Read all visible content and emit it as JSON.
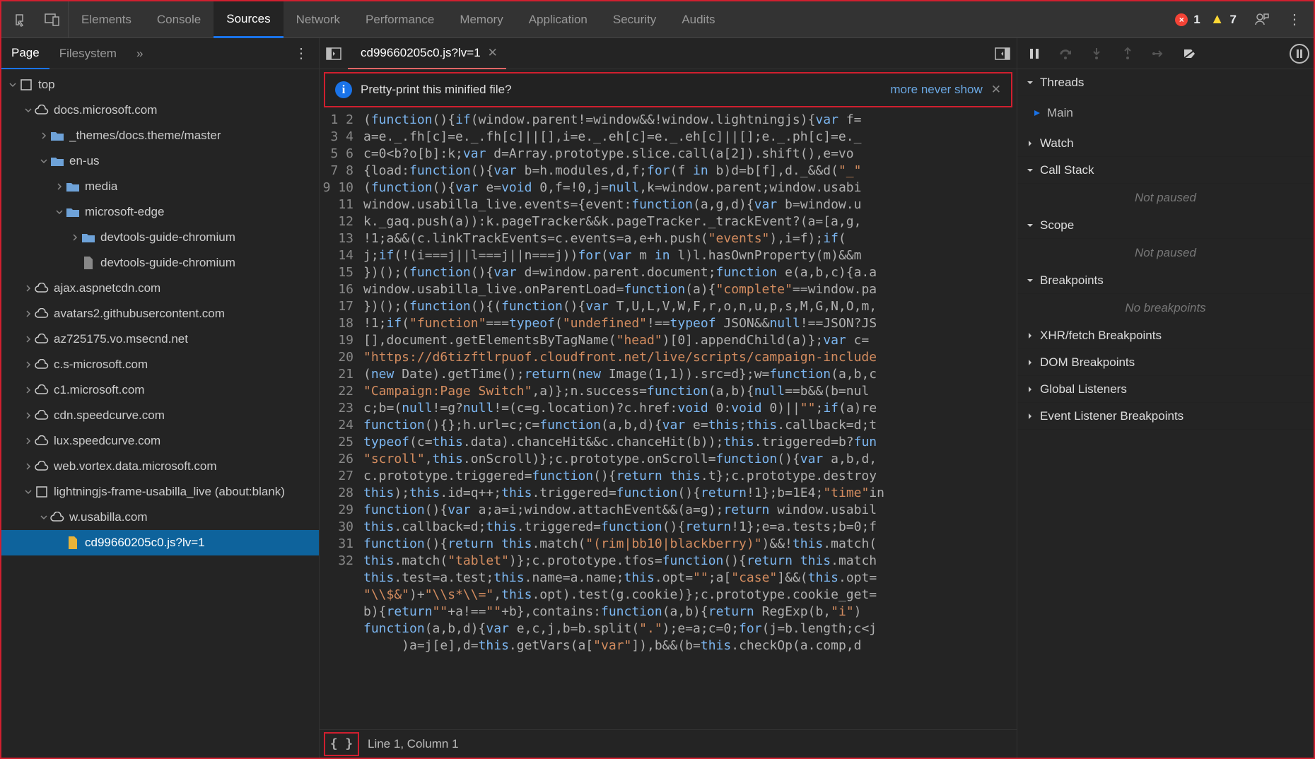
{
  "top_tabs": {
    "items": [
      "Elements",
      "Console",
      "Sources",
      "Network",
      "Performance",
      "Memory",
      "Application",
      "Security",
      "Audits"
    ],
    "active_index": 2,
    "errors": "1",
    "warnings": "7"
  },
  "left_tabs": {
    "items": [
      "Page",
      "Filesystem"
    ],
    "more": "»",
    "active_index": 0
  },
  "tree": [
    {
      "d": 0,
      "ic": "box",
      "arr": "d",
      "t": "top"
    },
    {
      "d": 1,
      "ic": "cloud",
      "arr": "d",
      "t": "docs.microsoft.com"
    },
    {
      "d": 2,
      "ic": "folder",
      "arr": "r",
      "t": "_themes/docs.theme/master"
    },
    {
      "d": 2,
      "ic": "folder",
      "arr": "d",
      "t": "en-us"
    },
    {
      "d": 3,
      "ic": "folder",
      "arr": "r",
      "t": "media"
    },
    {
      "d": 3,
      "ic": "folder",
      "arr": "d",
      "t": "microsoft-edge"
    },
    {
      "d": 4,
      "ic": "folder",
      "arr": "r",
      "t": "devtools-guide-chromium"
    },
    {
      "d": 4,
      "ic": "file",
      "arr": "",
      "t": "devtools-guide-chromium"
    },
    {
      "d": 1,
      "ic": "cloud",
      "arr": "r",
      "t": "ajax.aspnetcdn.com"
    },
    {
      "d": 1,
      "ic": "cloud",
      "arr": "r",
      "t": "avatars2.githubusercontent.com"
    },
    {
      "d": 1,
      "ic": "cloud",
      "arr": "r",
      "t": "az725175.vo.msecnd.net"
    },
    {
      "d": 1,
      "ic": "cloud",
      "arr": "r",
      "t": "c.s-microsoft.com"
    },
    {
      "d": 1,
      "ic": "cloud",
      "arr": "r",
      "t": "c1.microsoft.com"
    },
    {
      "d": 1,
      "ic": "cloud",
      "arr": "r",
      "t": "cdn.speedcurve.com"
    },
    {
      "d": 1,
      "ic": "cloud",
      "arr": "r",
      "t": "lux.speedcurve.com"
    },
    {
      "d": 1,
      "ic": "cloud",
      "arr": "r",
      "t": "web.vortex.data.microsoft.com"
    },
    {
      "d": 1,
      "ic": "box",
      "arr": "d",
      "t": "lightningjs-frame-usabilla_live (about:blank)"
    },
    {
      "d": 2,
      "ic": "cloud",
      "arr": "d",
      "t": "w.usabilla.com"
    },
    {
      "d": 3,
      "ic": "js",
      "arr": "",
      "t": "cd99660205c0.js?lv=1",
      "sel": true
    }
  ],
  "editor": {
    "tab_name": "cd99660205c0.js?lv=1",
    "info_text": "Pretty-print this minified file?",
    "info_link": "more never show",
    "status": "Line 1, Column 1",
    "pretty_label": "{ }"
  },
  "code_lines": [
    [
      {
        "c": "p",
        "t": "("
      },
      {
        "c": "k",
        "t": "function"
      },
      {
        "c": "p",
        "t": "(){"
      },
      {
        "c": "k",
        "t": "if"
      },
      {
        "c": "p",
        "t": "(window.parent!=window&&!window.lightningjs){"
      },
      {
        "c": "k",
        "t": "var"
      },
      {
        "c": "p",
        "t": " f="
      }
    ],
    [
      {
        "c": "p",
        "t": "a=e._.fh[c]=e._.fh[c]||[],i=e._.eh[c]=e._.eh[c]||[];e._.ph[c]=e._"
      }
    ],
    [
      {
        "c": "p",
        "t": "c=0<b?o[b]:k;"
      },
      {
        "c": "k",
        "t": "var"
      },
      {
        "c": "p",
        "t": " d=Array.prototype.slice.call(a[2]).shift(),e=vo"
      }
    ],
    [
      {
        "c": "p",
        "t": "{load:"
      },
      {
        "c": "k",
        "t": "function"
      },
      {
        "c": "p",
        "t": "(){"
      },
      {
        "c": "k",
        "t": "var"
      },
      {
        "c": "p",
        "t": " b=h.modules,d,f;"
      },
      {
        "c": "k",
        "t": "for"
      },
      {
        "c": "p",
        "t": "(f "
      },
      {
        "c": "k",
        "t": "in"
      },
      {
        "c": "p",
        "t": " b)d=b[f],d._&&d("
      },
      {
        "c": "s",
        "t": "\"_\""
      }
    ],
    [
      {
        "c": "p",
        "t": "("
      },
      {
        "c": "k",
        "t": "function"
      },
      {
        "c": "p",
        "t": "(){"
      },
      {
        "c": "k",
        "t": "var"
      },
      {
        "c": "p",
        "t": " e="
      },
      {
        "c": "k",
        "t": "void"
      },
      {
        "c": "p",
        "t": " 0,f=!0,j="
      },
      {
        "c": "k",
        "t": "null"
      },
      {
        "c": "p",
        "t": ",k=window.parent;window.usabi"
      }
    ],
    [
      {
        "c": "p",
        "t": "window.usabilla_live.events={event:"
      },
      {
        "c": "k",
        "t": "function"
      },
      {
        "c": "p",
        "t": "(a,g,d){"
      },
      {
        "c": "k",
        "t": "var"
      },
      {
        "c": "p",
        "t": " b=window.u"
      }
    ],
    [
      {
        "c": "p",
        "t": "k._gaq.push(a)):k.pageTracker&&k.pageTracker._trackEvent?(a=[a,g,"
      }
    ],
    [
      {
        "c": "p",
        "t": "!1;a&&(c.linkTrackEvents=c.events=a,e+h.push("
      },
      {
        "c": "s",
        "t": "\"events\""
      },
      {
        "c": "p",
        "t": "),i=f);"
      },
      {
        "c": "k",
        "t": "if"
      },
      {
        "c": "p",
        "t": "("
      }
    ],
    [
      {
        "c": "p",
        "t": "j;"
      },
      {
        "c": "k",
        "t": "if"
      },
      {
        "c": "p",
        "t": "(!(i===j||l===j||n===j))"
      },
      {
        "c": "k",
        "t": "for"
      },
      {
        "c": "p",
        "t": "("
      },
      {
        "c": "k",
        "t": "var"
      },
      {
        "c": "p",
        "t": " m "
      },
      {
        "c": "k",
        "t": "in"
      },
      {
        "c": "p",
        "t": " l)l.hasOwnProperty(m)&&m"
      }
    ],
    [
      {
        "c": "p",
        "t": "})();("
      },
      {
        "c": "k",
        "t": "function"
      },
      {
        "c": "p",
        "t": "(){"
      },
      {
        "c": "k",
        "t": "var"
      },
      {
        "c": "p",
        "t": " d=window.parent.document;"
      },
      {
        "c": "k",
        "t": "function"
      },
      {
        "c": "p",
        "t": " e(a,b,c){a.a"
      }
    ],
    [
      {
        "c": "p",
        "t": "window.usabilla_live.onParentLoad="
      },
      {
        "c": "k",
        "t": "function"
      },
      {
        "c": "p",
        "t": "(a){"
      },
      {
        "c": "s",
        "t": "\"complete\""
      },
      {
        "c": "p",
        "t": "==window.pa"
      }
    ],
    [
      {
        "c": "p",
        "t": "})();("
      },
      {
        "c": "k",
        "t": "function"
      },
      {
        "c": "p",
        "t": "(){("
      },
      {
        "c": "k",
        "t": "function"
      },
      {
        "c": "p",
        "t": "(){"
      },
      {
        "c": "k",
        "t": "var"
      },
      {
        "c": "p",
        "t": " T,U,L,V,W,F,r,o,n,u,p,s,M,G,N,O,m,"
      }
    ],
    [
      {
        "c": "p",
        "t": "!1;"
      },
      {
        "c": "k",
        "t": "if"
      },
      {
        "c": "p",
        "t": "("
      },
      {
        "c": "s",
        "t": "\"function\""
      },
      {
        "c": "p",
        "t": "==="
      },
      {
        "c": "k",
        "t": "typeof"
      },
      {
        "c": "p",
        "t": "("
      },
      {
        "c": "s",
        "t": "\"undefined\""
      },
      {
        "c": "p",
        "t": "!=="
      },
      {
        "c": "k",
        "t": "typeof"
      },
      {
        "c": "p",
        "t": " JSON&&"
      },
      {
        "c": "k",
        "t": "null"
      },
      {
        "c": "p",
        "t": "!==JSON?JS"
      }
    ],
    [
      {
        "c": "p",
        "t": "[],document.getElementsByTagName("
      },
      {
        "c": "s",
        "t": "\"head\""
      },
      {
        "c": "p",
        "t": ")[0].appendChild(a)};"
      },
      {
        "c": "k",
        "t": "var"
      },
      {
        "c": "p",
        "t": " c="
      }
    ],
    [
      {
        "c": "s",
        "t": "\"https://d6tizftlrpuof.cloudfront.net/live/scripts/campaign-include"
      }
    ],
    [
      {
        "c": "p",
        "t": "("
      },
      {
        "c": "k",
        "t": "new"
      },
      {
        "c": "p",
        "t": " Date).getTime();"
      },
      {
        "c": "k",
        "t": "return"
      },
      {
        "c": "p",
        "t": "("
      },
      {
        "c": "k",
        "t": "new"
      },
      {
        "c": "p",
        "t": " Image(1,1)).src=d};w="
      },
      {
        "c": "k",
        "t": "function"
      },
      {
        "c": "p",
        "t": "(a,b,c"
      }
    ],
    [
      {
        "c": "s",
        "t": "\"Campaign:Page Switch\""
      },
      {
        "c": "p",
        "t": ",a)};n.success="
      },
      {
        "c": "k",
        "t": "function"
      },
      {
        "c": "p",
        "t": "(a,b){"
      },
      {
        "c": "k",
        "t": "null"
      },
      {
        "c": "p",
        "t": "==b&&(b=nul"
      }
    ],
    [
      {
        "c": "p",
        "t": "c;b=("
      },
      {
        "c": "k",
        "t": "null"
      },
      {
        "c": "p",
        "t": "!=g?"
      },
      {
        "c": "k",
        "t": "null"
      },
      {
        "c": "p",
        "t": "!=(c=g.location)?c.href:"
      },
      {
        "c": "k",
        "t": "void"
      },
      {
        "c": "p",
        "t": " 0:"
      },
      {
        "c": "k",
        "t": "void"
      },
      {
        "c": "p",
        "t": " 0)||"
      },
      {
        "c": "s",
        "t": "\"\""
      },
      {
        "c": "p",
        "t": ";"
      },
      {
        "c": "k",
        "t": "if"
      },
      {
        "c": "p",
        "t": "(a)re"
      }
    ],
    [
      {
        "c": "k",
        "t": "function"
      },
      {
        "c": "p",
        "t": "(){};h.url=c;c="
      },
      {
        "c": "k",
        "t": "function"
      },
      {
        "c": "p",
        "t": "(a,b,d){"
      },
      {
        "c": "k",
        "t": "var"
      },
      {
        "c": "p",
        "t": " e="
      },
      {
        "c": "k",
        "t": "this"
      },
      {
        "c": "p",
        "t": ";"
      },
      {
        "c": "k",
        "t": "this"
      },
      {
        "c": "p",
        "t": ".callback=d;t"
      }
    ],
    [
      {
        "c": "k",
        "t": "typeof"
      },
      {
        "c": "p",
        "t": "(c="
      },
      {
        "c": "k",
        "t": "this"
      },
      {
        "c": "p",
        "t": ".data).chanceHit&&c.chanceHit(b));"
      },
      {
        "c": "k",
        "t": "this"
      },
      {
        "c": "p",
        "t": ".triggered=b?"
      },
      {
        "c": "k",
        "t": "fun"
      }
    ],
    [
      {
        "c": "s",
        "t": "\"scroll\""
      },
      {
        "c": "p",
        "t": ","
      },
      {
        "c": "k",
        "t": "this"
      },
      {
        "c": "p",
        "t": ".onScroll)};c.prototype.onScroll="
      },
      {
        "c": "k",
        "t": "function"
      },
      {
        "c": "p",
        "t": "(){"
      },
      {
        "c": "k",
        "t": "var"
      },
      {
        "c": "p",
        "t": " a,b,d,"
      }
    ],
    [
      {
        "c": "p",
        "t": "c.prototype.triggered="
      },
      {
        "c": "k",
        "t": "function"
      },
      {
        "c": "p",
        "t": "(){"
      },
      {
        "c": "k",
        "t": "return this"
      },
      {
        "c": "p",
        "t": ".t};c.prototype.destroy"
      }
    ],
    [
      {
        "c": "k",
        "t": "this"
      },
      {
        "c": "p",
        "t": ");"
      },
      {
        "c": "k",
        "t": "this"
      },
      {
        "c": "p",
        "t": ".id=q++;"
      },
      {
        "c": "k",
        "t": "this"
      },
      {
        "c": "p",
        "t": ".triggered="
      },
      {
        "c": "k",
        "t": "function"
      },
      {
        "c": "p",
        "t": "(){"
      },
      {
        "c": "k",
        "t": "return"
      },
      {
        "c": "p",
        "t": "!1};b=1E4;"
      },
      {
        "c": "s",
        "t": "\"time\""
      },
      {
        "c": "p",
        "t": "in"
      }
    ],
    [
      {
        "c": "k",
        "t": "function"
      },
      {
        "c": "p",
        "t": "(){"
      },
      {
        "c": "k",
        "t": "var"
      },
      {
        "c": "p",
        "t": " a;a=i;window.attachEvent&&(a=g);"
      },
      {
        "c": "k",
        "t": "return"
      },
      {
        "c": "p",
        "t": " window.usabil"
      }
    ],
    [
      {
        "c": "k",
        "t": "this"
      },
      {
        "c": "p",
        "t": ".callback=d;"
      },
      {
        "c": "k",
        "t": "this"
      },
      {
        "c": "p",
        "t": ".triggered="
      },
      {
        "c": "k",
        "t": "function"
      },
      {
        "c": "p",
        "t": "(){"
      },
      {
        "c": "k",
        "t": "return"
      },
      {
        "c": "p",
        "t": "!1};e=a.tests;b=0;f"
      }
    ],
    [
      {
        "c": "k",
        "t": "function"
      },
      {
        "c": "p",
        "t": "(){"
      },
      {
        "c": "k",
        "t": "return this"
      },
      {
        "c": "p",
        "t": ".match("
      },
      {
        "c": "s",
        "t": "\"(rim|bb10|blackberry)\""
      },
      {
        "c": "p",
        "t": ")&&!"
      },
      {
        "c": "k",
        "t": "this"
      },
      {
        "c": "p",
        "t": ".match("
      }
    ],
    [
      {
        "c": "k",
        "t": "this"
      },
      {
        "c": "p",
        "t": ".match("
      },
      {
        "c": "s",
        "t": "\"tablet\""
      },
      {
        "c": "p",
        "t": ")};c.prototype.tfos="
      },
      {
        "c": "k",
        "t": "function"
      },
      {
        "c": "p",
        "t": "(){"
      },
      {
        "c": "k",
        "t": "return this"
      },
      {
        "c": "p",
        "t": ".match"
      }
    ],
    [
      {
        "c": "k",
        "t": "this"
      },
      {
        "c": "p",
        "t": ".test=a.test;"
      },
      {
        "c": "k",
        "t": "this"
      },
      {
        "c": "p",
        "t": ".name=a.name;"
      },
      {
        "c": "k",
        "t": "this"
      },
      {
        "c": "p",
        "t": ".opt="
      },
      {
        "c": "s",
        "t": "\"\""
      },
      {
        "c": "p",
        "t": ";a["
      },
      {
        "c": "s",
        "t": "\"case\""
      },
      {
        "c": "p",
        "t": "]&&("
      },
      {
        "c": "k",
        "t": "this"
      },
      {
        "c": "p",
        "t": ".opt="
      }
    ],
    [
      {
        "c": "s",
        "t": "\"\\\\$&\""
      },
      {
        "c": "p",
        "t": ")+"
      },
      {
        "c": "s",
        "t": "\"\\\\s*\\\\=\""
      },
      {
        "c": "p",
        "t": ","
      },
      {
        "c": "k",
        "t": "this"
      },
      {
        "c": "p",
        "t": ".opt).test(g.cookie)};c.prototype.cookie_get="
      }
    ],
    [
      {
        "c": "p",
        "t": "b){"
      },
      {
        "c": "k",
        "t": "return"
      },
      {
        "c": "s",
        "t": "\"\""
      },
      {
        "c": "p",
        "t": "+a!=="
      },
      {
        "c": "s",
        "t": "\"\""
      },
      {
        "c": "p",
        "t": "+b},contains:"
      },
      {
        "c": "k",
        "t": "function"
      },
      {
        "c": "p",
        "t": "(a,b){"
      },
      {
        "c": "k",
        "t": "return"
      },
      {
        "c": "p",
        "t": " RegExp(b,"
      },
      {
        "c": "s",
        "t": "\"i\""
      },
      {
        "c": "p",
        "t": ")"
      }
    ],
    [
      {
        "c": "k",
        "t": "function"
      },
      {
        "c": "p",
        "t": "(a,b,d){"
      },
      {
        "c": "k",
        "t": "var"
      },
      {
        "c": "p",
        "t": " e,c,j,b=b.split("
      },
      {
        "c": "s",
        "t": "\".\""
      },
      {
        "c": "p",
        "t": ");e=a;c=0;"
      },
      {
        "c": "k",
        "t": "for"
      },
      {
        "c": "p",
        "t": "(j=b.length;c<j"
      }
    ],
    [
      {
        "c": "p",
        "t": "     )a=j[e],d="
      },
      {
        "c": "k",
        "t": "this"
      },
      {
        "c": "p",
        "t": ".getVars(a["
      },
      {
        "c": "s",
        "t": "\"var\""
      },
      {
        "c": "p",
        "t": "]),b&&(b="
      },
      {
        "c": "k",
        "t": "this"
      },
      {
        "c": "p",
        "t": ".checkOp(a.comp,d"
      }
    ]
  ],
  "right": {
    "sections": [
      {
        "label": "Threads",
        "open": true,
        "body_type": "threads",
        "items": [
          {
            "label": "Main",
            "active": true
          }
        ]
      },
      {
        "label": "Watch",
        "open": false
      },
      {
        "label": "Call Stack",
        "open": true,
        "body_type": "faded",
        "body": "Not paused"
      },
      {
        "label": "Scope",
        "open": true,
        "body_type": "faded",
        "body": "Not paused"
      },
      {
        "label": "Breakpoints",
        "open": true,
        "body_type": "faded",
        "body": "No breakpoints"
      },
      {
        "label": "XHR/fetch Breakpoints",
        "open": false
      },
      {
        "label": "DOM Breakpoints",
        "open": false
      },
      {
        "label": "Global Listeners",
        "open": false
      },
      {
        "label": "Event Listener Breakpoints",
        "open": false
      }
    ]
  }
}
